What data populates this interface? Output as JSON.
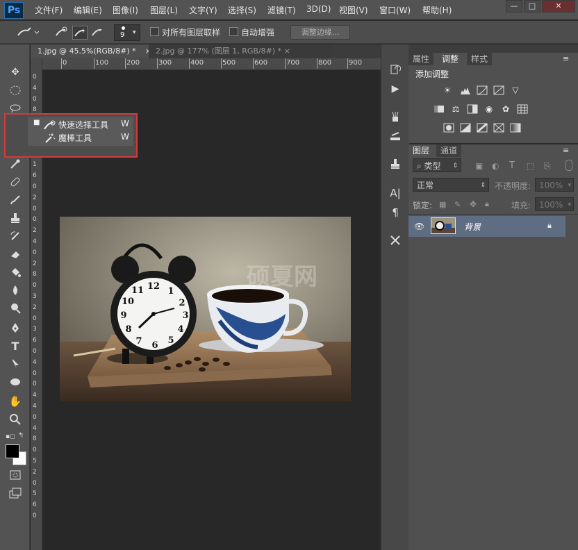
{
  "app": {
    "logo": "Ps"
  },
  "menubar": {
    "items": [
      "文件(F)",
      "编辑(E)",
      "图像(I)",
      "图层(L)",
      "文字(Y)",
      "选择(S)",
      "滤镜(T)",
      "3D(D)",
      "视图(V)",
      "窗口(W)",
      "帮助(H)"
    ]
  },
  "window_controls": {
    "minimize": "—",
    "maximize": "□",
    "close": "✕"
  },
  "options": {
    "brush_size": "9",
    "sample_all_layers": "对所有图层取样",
    "auto_enhance": "自动增强",
    "refine_edge": "调整边缘..."
  },
  "tabs": [
    {
      "label": "1.jpg @ 45.5%(RGB/8#) *",
      "close": "×"
    },
    {
      "label": "2.jpg @ 177% (图层 1, RGB/8#) *",
      "close": "×"
    }
  ],
  "ruler_h": [
    "0",
    "100",
    "200",
    "300",
    "400",
    "500",
    "600",
    "700",
    "800",
    "900"
  ],
  "ruler_v": [
    "0",
    "4",
    "0",
    "8",
    "0",
    "1",
    "2",
    "0",
    "1",
    "6",
    "0",
    "2",
    "0",
    "0",
    "2",
    "4",
    "0",
    "2",
    "8",
    "0",
    "3",
    "2",
    "0",
    "3",
    "6",
    "0",
    "4",
    "0",
    "0",
    "4",
    "4",
    "0",
    "4",
    "8",
    "0",
    "5",
    "2",
    "0",
    "5",
    "6",
    "0"
  ],
  "flyout": {
    "items": [
      {
        "label": "快速选择工具",
        "key": "W",
        "selected": true
      },
      {
        "label": "魔棒工具",
        "key": "W",
        "selected": false
      }
    ]
  },
  "photo": {
    "watermark": "硕夏网"
  },
  "panels": {
    "top_tabs": [
      "属性",
      "调整",
      "样式"
    ],
    "adjust_title": "添加调整",
    "bottom_tabs": [
      "图层",
      "通道"
    ],
    "kind_filter": "类型",
    "blend_mode": "正常",
    "opacity_label": "不透明度:",
    "opacity_value": "100%",
    "lock_label": "锁定:",
    "fill_label": "填充:",
    "fill_value": "100%",
    "layer_name": "背景"
  },
  "colors": {
    "accent_highlight": "#d43a3a",
    "layer_selected": "#5f6d82"
  }
}
